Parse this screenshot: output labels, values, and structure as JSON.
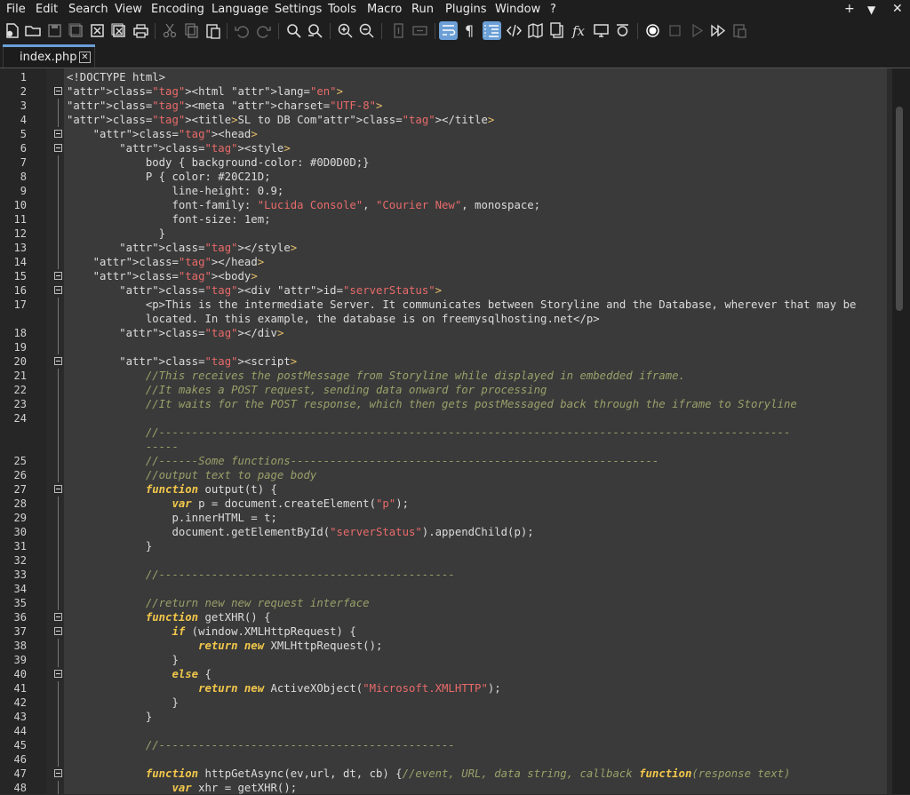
{
  "menu": {
    "items": [
      "File",
      "Edit",
      "Search",
      "View",
      "Encoding",
      "Language",
      "Settings",
      "Tools",
      "Macro",
      "Run",
      "Plugins",
      "Window",
      "?"
    ],
    "right_controls": [
      "+",
      "▼",
      "✕"
    ]
  },
  "toolbar": {
    "buttons": [
      "new-file",
      "open-file",
      "save",
      "save-all",
      "close",
      "close-all",
      "print",
      "cut",
      "copy",
      "paste",
      "undo",
      "redo",
      "find",
      "replace",
      "zoom-in",
      "zoom-out",
      "sync-vertical",
      "sync-horizontal",
      "word-wrap",
      "show-all-characters",
      "indent-guide",
      "user-defined-language",
      "document-map",
      "function-list",
      "fx",
      "monitoring",
      "folder-as-workspace",
      "start-recording",
      "stop-recording",
      "playback",
      "run-macro-multiple",
      "save-macro"
    ],
    "active": [
      "word-wrap",
      "indent-guide"
    ]
  },
  "tab": {
    "label": "index.php",
    "close_label": "✕"
  },
  "editor": {
    "lines": [
      {
        "n": "1",
        "text": "<!DOCTYPE html>",
        "kind": "plain"
      },
      {
        "n": "2",
        "text": "<html lang=\"en\">",
        "kind": "tag"
      },
      {
        "n": "3",
        "text": "<meta charset=\"UTF-8\">",
        "kind": "tag"
      },
      {
        "n": "4",
        "text": "<title>SL to DB Com</title>",
        "kind": "tag"
      },
      {
        "n": "5",
        "text": "    <head>",
        "kind": "tag"
      },
      {
        "n": "6",
        "text": "        <style>",
        "kind": "tag"
      },
      {
        "n": "7",
        "text": "            body { background-color: #0D0D0D;}",
        "kind": "plain"
      },
      {
        "n": "8",
        "text": "            P { color: #20C21D;",
        "kind": "plain"
      },
      {
        "n": "9",
        "text": "                line-height: 0.9;",
        "kind": "plain"
      },
      {
        "n": "10",
        "text": "                font-family: \"Lucida Console\", \"Courier New\", monospace;",
        "kind": "plain"
      },
      {
        "n": "11",
        "text": "                font-size: 1em;",
        "kind": "plain"
      },
      {
        "n": "12",
        "text": "              }",
        "kind": "plain"
      },
      {
        "n": "13",
        "text": "        </style>",
        "kind": "tag"
      },
      {
        "n": "14",
        "text": "    </head>",
        "kind": "tag"
      },
      {
        "n": "15",
        "text": "    <body>",
        "kind": "tag"
      },
      {
        "n": "16",
        "text": "        <div id=\"serverStatus\">",
        "kind": "tag"
      },
      {
        "n": "17",
        "text": "            <p>This is the intermediate Server. It communicates between Storyline and the Database, wherever that may be",
        "kind": "plain"
      },
      {
        "n": "",
        "text": "            located. In this example, the database is on freemysqlhosting.net</p>",
        "kind": "plain"
      },
      {
        "n": "18",
        "text": "        </div>",
        "kind": "tag"
      },
      {
        "n": "19",
        "text": "",
        "kind": "plain"
      },
      {
        "n": "20",
        "text": "        <script>",
        "kind": "tag"
      },
      {
        "n": "21",
        "text": "            //This receives the postMessage from Storyline while displayed in embedded iframe.",
        "kind": "cmt"
      },
      {
        "n": "22",
        "text": "            //It makes a POST request, sending data onward for processing",
        "kind": "cmt"
      },
      {
        "n": "23",
        "text": "            //It waits for the POST response, which then gets postMessaged back through the iframe to Storyline",
        "kind": "cmt"
      },
      {
        "n": "24",
        "text": "",
        "kind": "plain"
      },
      {
        "n": "",
        "text": "            //------------------------------------------------------------------------------------------------",
        "kind": "cmt"
      },
      {
        "n": "",
        "text": "            -----",
        "kind": "cmt"
      },
      {
        "n": "25",
        "text": "            //------Some functions--------------------------------------------------------",
        "kind": "cmt"
      },
      {
        "n": "26",
        "text": "            //output text to page body",
        "kind": "cmt"
      },
      {
        "n": "27",
        "text": "            function output(t) {",
        "kind": "fn"
      },
      {
        "n": "28",
        "text": "                var p = document.createElement(\"p\");",
        "kind": "var"
      },
      {
        "n": "29",
        "text": "                p.innerHTML = t;",
        "kind": "plain"
      },
      {
        "n": "30",
        "text": "                document.getElementById(\"serverStatus\").appendChild(p);",
        "kind": "str"
      },
      {
        "n": "31",
        "text": "            }",
        "kind": "plain"
      },
      {
        "n": "32",
        "text": "",
        "kind": "plain"
      },
      {
        "n": "33",
        "text": "            //---------------------------------------------",
        "kind": "cmt"
      },
      {
        "n": "34",
        "text": "",
        "kind": "plain"
      },
      {
        "n": "35",
        "text": "            //return new new request interface",
        "kind": "cmt"
      },
      {
        "n": "36",
        "text": "            function getXHR() {",
        "kind": "fn"
      },
      {
        "n": "37",
        "text": "                if (window.XMLHttpRequest) {",
        "kind": "if"
      },
      {
        "n": "38",
        "text": "                    return new XMLHttpRequest();",
        "kind": "ret"
      },
      {
        "n": "39",
        "text": "                }",
        "kind": "plain"
      },
      {
        "n": "40",
        "text": "                else {",
        "kind": "else"
      },
      {
        "n": "41",
        "text": "                    return new ActiveXObject(\"Microsoft.XMLHTTP\");",
        "kind": "ret"
      },
      {
        "n": "42",
        "text": "                }",
        "kind": "plain"
      },
      {
        "n": "43",
        "text": "            }",
        "kind": "plain"
      },
      {
        "n": "44",
        "text": "",
        "kind": "plain"
      },
      {
        "n": "45",
        "text": "            //---------------------------------------------",
        "kind": "cmt"
      },
      {
        "n": "46",
        "text": "",
        "kind": "plain"
      },
      {
        "n": "47",
        "text": "            function httpGetAsync(ev,url, dt, cb) {//event, URL, data string, callback function(response text)",
        "kind": "fn"
      },
      {
        "n": "48",
        "text": "                var xhr = getXHR();",
        "kind": "var"
      }
    ]
  }
}
